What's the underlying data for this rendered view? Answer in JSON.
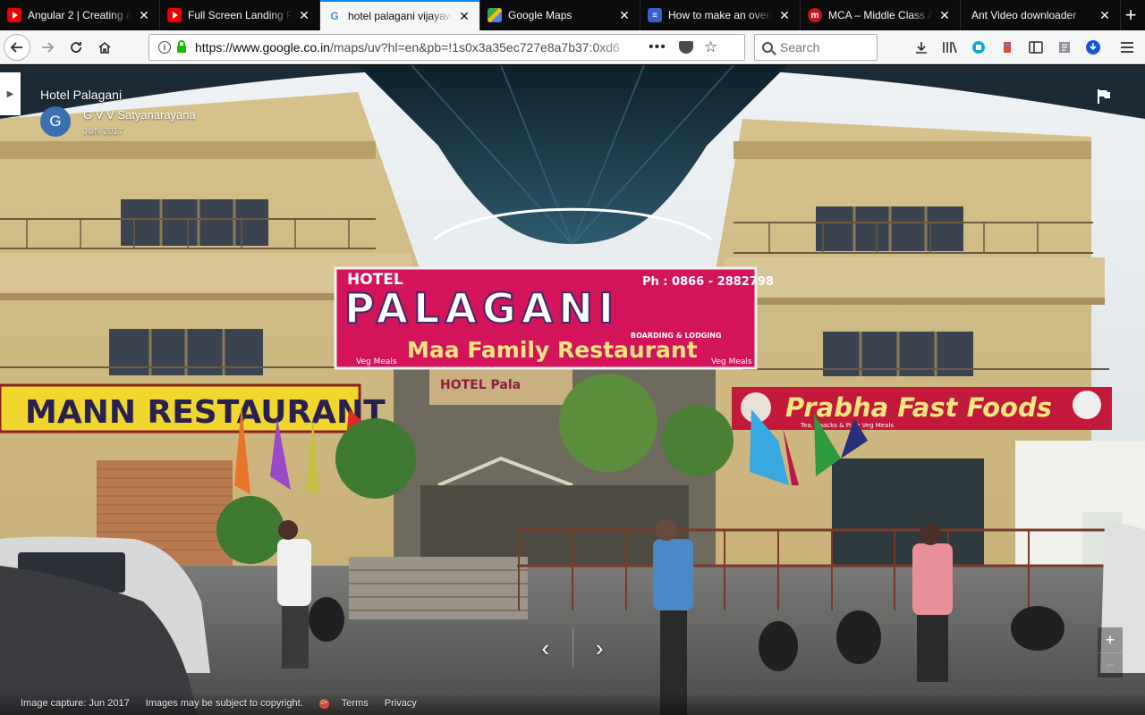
{
  "tabs": [
    {
      "title": "Angular 2 | Creating a",
      "favicon": "youtube-icon",
      "active": false
    },
    {
      "title": "Full Screen Landing Pa",
      "favicon": "youtube-icon",
      "active": false
    },
    {
      "title": "hotel palagani vijayawa",
      "favicon": "google-icon",
      "active": true
    },
    {
      "title": "Google Maps",
      "favicon": "google-maps-icon",
      "active": false
    },
    {
      "title": "How to make an overla",
      "favicon": "site-icon",
      "active": false
    },
    {
      "title": "MCA – Middle Class Al",
      "favicon": "m-icon",
      "active": false
    },
    {
      "title": "Ant Video downloader",
      "favicon": "",
      "active": false
    }
  ],
  "new_tab_label": "+",
  "navbar": {
    "url_domain": "https://www.google.co.in",
    "url_path": "/maps/uv?hl=en&pb=!1s0x3a35ec727e8a7b37:0xd6",
    "more_label": "•••",
    "search_placeholder": "Search"
  },
  "streetview": {
    "place_title": "Hotel Palagani",
    "avatar_letter": "G",
    "author": "G V V Satyanarayana",
    "date": "JUN 2017",
    "prev_label": "‹",
    "next_label": "›",
    "zoom_in": "+",
    "zoom_out": "−"
  },
  "scene_signs": {
    "hotel": "HOTEL",
    "palagani": "PALAGANI",
    "phone": "Ph : 0866 - 2882798",
    "boarding": "BOARDING & LODGING",
    "restaurant": "Maa Family Restaurant",
    "veg_left": "Veg Meals",
    "veg_right": "Veg Meals",
    "mann": "MANN RESTAURANT",
    "prabha": "Prabha Fast Foods",
    "prabha_sub": "Tea, Snacks & Pure Veg Meals"
  },
  "footer": {
    "capture": "Image capture: Jun 2017",
    "copyright": "Images may be subject to copyright.",
    "terms": "Terms",
    "privacy": "Privacy"
  },
  "colors": {
    "accent": "#0a84ff",
    "sign_red": "#d81b60",
    "building": "#d9c493"
  }
}
